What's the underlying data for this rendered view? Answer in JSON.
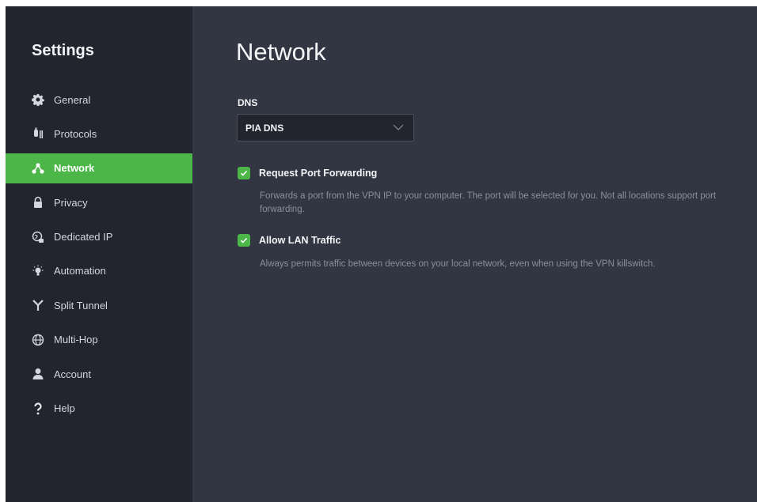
{
  "sidebar": {
    "title": "Settings",
    "items": [
      {
        "label": "General",
        "icon": "gear-icon",
        "active": false
      },
      {
        "label": "Protocols",
        "icon": "protocols-icon",
        "active": false
      },
      {
        "label": "Network",
        "icon": "network-icon",
        "active": true
      },
      {
        "label": "Privacy",
        "icon": "lock-icon",
        "active": false
      },
      {
        "label": "Dedicated IP",
        "icon": "dedicated-ip-icon",
        "active": false
      },
      {
        "label": "Automation",
        "icon": "lightbulb-icon",
        "active": false
      },
      {
        "label": "Split Tunnel",
        "icon": "split-tunnel-icon",
        "active": false
      },
      {
        "label": "Multi-Hop",
        "icon": "globe-icon",
        "active": false
      },
      {
        "label": "Account",
        "icon": "person-icon",
        "active": false
      },
      {
        "label": "Help",
        "icon": "question-icon",
        "active": false
      }
    ]
  },
  "main": {
    "title": "Network",
    "dns": {
      "label": "DNS",
      "selected": "PIA DNS"
    },
    "options": [
      {
        "label": "Request Port Forwarding",
        "checked": true,
        "description": "Forwards a port from the VPN IP to your computer. The port will be selected for you. Not all locations support port forwarding."
      },
      {
        "label": "Allow LAN Traffic",
        "checked": true,
        "description": "Always permits traffic between devices on your local network, even when using the VPN killswitch."
      }
    ]
  },
  "colors": {
    "accent": "#4cb649",
    "sidebar_bg": "#22252e",
    "main_bg": "#323642"
  }
}
